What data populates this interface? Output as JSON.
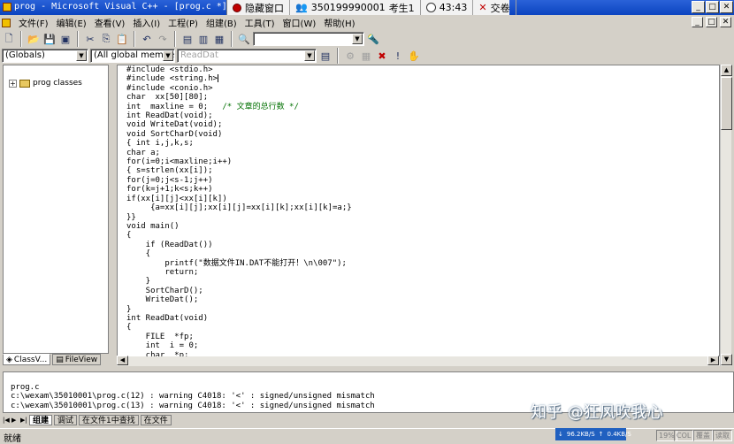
{
  "window": {
    "title": "prog - Microsoft Visual C++ - [prog.c *]"
  },
  "exam_bar": {
    "hide_label": "隐藏窗口",
    "candidate_id": "350199990001",
    "candidate_label": "考生1",
    "timer": "43:43",
    "papers_label": "交卷"
  },
  "menu": [
    "文件(F)",
    "编辑(E)",
    "查看(V)",
    "插入(I)",
    "工程(P)",
    "组建(B)",
    "工具(T)",
    "窗口(W)",
    "帮助(H)"
  ],
  "toolbar2": {
    "scope_combo": "(Globals)",
    "members_combo": "(All global members",
    "function_combo": "ReadDat"
  },
  "class_view": {
    "root_label": "prog classes",
    "tabs": [
      "ClassV...",
      "FileView"
    ]
  },
  "code": {
    "lines": [
      "#include <stdio.h>",
      "#include <string.h>",
      "#include <conio.h>",
      "char  xx[50][80];",
      "int  maxline = 0;",
      "int ReadDat(void);",
      "void WriteDat(void);",
      "void SortCharD(void)",
      "{ int i,j,k,s;",
      "char a;",
      "for(i=0;i<maxline;i++)",
      "{ s=strlen(xx[i]);",
      "for(j=0;j<s-1;j++)",
      "for(k=j+1;k<s;k++)",
      "if(xx[i][j]<xx[i][k])",
      "     {a=xx[i][j];xx[i][j]=xx[i][k];xx[i][k]=a;}",
      "}}",
      "void main()",
      "{",
      "    if (ReadDat())",
      "    {",
      "        printf(\"数据文件IN.DAT不能打开！\\n\\007\");",
      "        return;",
      "    }",
      "    SortCharD();",
      "    WriteDat();",
      "}",
      "int ReadDat(void)",
      "{",
      "    FILE  *fp;",
      "    int  i = 0;",
      "    char  *p;"
    ],
    "comment": "/* 文章的总行数 */"
  },
  "output": {
    "lines": [
      "prog.c",
      "c:\\wexam\\35010001\\prog.c(12) : warning C4018: '<' : signed/unsigned mismatch",
      "c:\\wexam\\35010001\\prog.c(13) : warning C4018: '<' : signed/unsigned mismatch"
    ],
    "tabs": [
      "组建",
      "调试",
      "在文件1中查找",
      "在文件"
    ]
  },
  "watermark": "知乎 @狂风吹我心",
  "status": {
    "text": "就绪",
    "net_down": "96.2KB/S",
    "net_up": "0.4KB/S",
    "percent": "19%",
    "cells": [
      "COL",
      "覆盖",
      "读取"
    ]
  },
  "colors": {
    "titlebar": "#0b44c0",
    "face": "#d4d0c8",
    "comment": "#007000"
  }
}
